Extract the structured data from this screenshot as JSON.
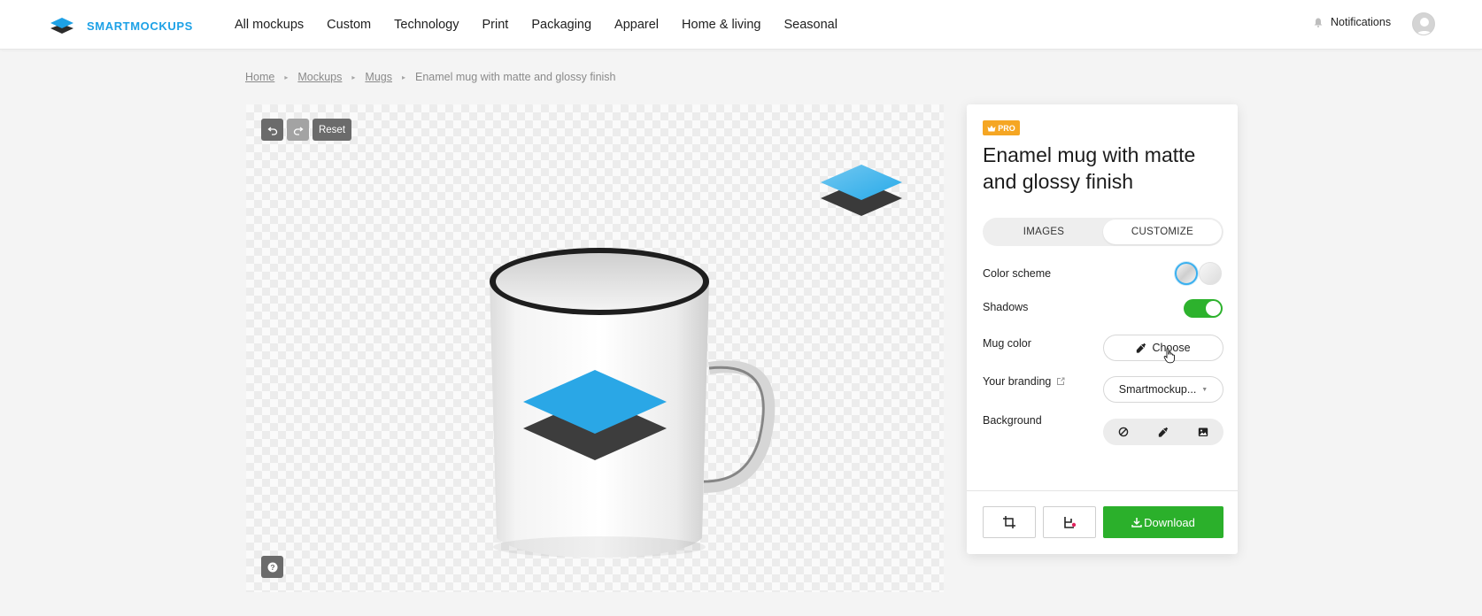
{
  "brand": {
    "name": "SMARTMOCKUPS",
    "icon": "layers-logo-icon"
  },
  "nav": [
    "All mockups",
    "Custom",
    "Technology",
    "Print",
    "Packaging",
    "Apparel",
    "Home & living",
    "Seasonal"
  ],
  "header": {
    "notifications": "Notifications",
    "notifications_icon": "bell-icon",
    "avatar_icon": "user-avatar-icon"
  },
  "breadcrumb": [
    "Home",
    "Mockups",
    "Mugs",
    "Enamel mug with matte and glossy finish"
  ],
  "canvas": {
    "undo_icon": "undo-icon",
    "redo_icon": "redo-icon",
    "reset_label": "Reset",
    "help_icon": "question-icon"
  },
  "panel": {
    "badge": "PRO",
    "title": "Enamel mug with matte and glossy finish",
    "tabs": [
      "IMAGES",
      "CUSTOMIZE"
    ],
    "active_tab": "CUSTOMIZE",
    "color_scheme_label": "Color scheme",
    "shadows_label": "Shadows",
    "shadows_on": true,
    "mug_color_label": "Mug color",
    "mug_color_button": "Choose",
    "branding_label": "Your branding",
    "branding_value": "Smartmockup...",
    "background_label": "Background",
    "background_options": [
      "none-icon",
      "color-picker-icon",
      "image-icon"
    ],
    "download_label": "Download"
  },
  "colors": {
    "brand": "#1da1e6",
    "pro": "#f5a623",
    "toggle": "#2db22d",
    "download": "#2bb02b"
  }
}
